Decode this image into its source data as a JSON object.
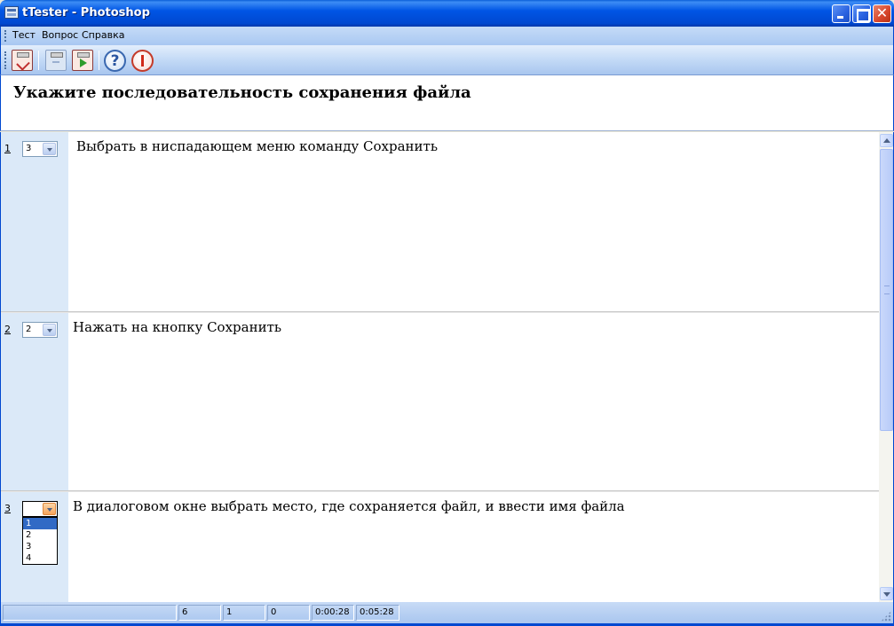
{
  "window": {
    "title": "tTester - Photoshop",
    "close_glyph": "✕"
  },
  "menu": {
    "items": [
      "Тест",
      "Вопрос",
      "Справка"
    ]
  },
  "toolbar": {
    "buttons": [
      {
        "icon": "test-checklist-icon",
        "enabled": true
      },
      {
        "icon": "previous-question-icon",
        "enabled": false
      },
      {
        "icon": "next-question-icon",
        "enabled": true
      },
      {
        "icon": "help-icon",
        "glyph": "?"
      },
      {
        "icon": "stop-icon"
      }
    ]
  },
  "question": {
    "text": "Укажите последовательность сохранения файла"
  },
  "answers": [
    {
      "number": "1",
      "selected": "3",
      "text": "Выбрать в ниспадающем меню команду Сохранить"
    },
    {
      "number": "2",
      "selected": "2",
      "text": "Нажать на кнопку Сохранить"
    },
    {
      "number": "3",
      "selected": "",
      "text": "В диалоговом окне выбрать место, где сохраняется файл, и ввести имя файла"
    }
  ],
  "dropdown": {
    "options": [
      "1",
      "2",
      "3",
      "4"
    ],
    "highlighted": "1"
  },
  "status": {
    "panels": [
      "",
      "6",
      "1",
      "0",
      "0:00:28",
      "0:05:28"
    ]
  }
}
